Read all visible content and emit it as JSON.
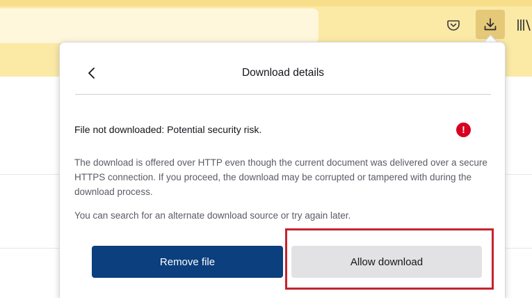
{
  "toolbar": {
    "pocket_icon": "pocket-icon",
    "downloads_icon": "download-arrow-icon",
    "library_icon": "library-icon",
    "accent_color": "#fbe9a6"
  },
  "panel": {
    "title": "Download details",
    "back_icon": "chevron-left-icon",
    "warning_heading": "File not downloaded: Potential security risk.",
    "warning_icon_glyph": "!",
    "warning_body": "The download is offered over HTTP even though the current document was delivered over a secure HTTPS connection. If you proceed, the download may be corrupted or tampered with during the download process.",
    "warning_hint": "You can search for an alternate download source or try again later.",
    "remove_label": "Remove file",
    "allow_label": "Allow download",
    "primary_color": "#0b3f7e",
    "warning_color": "#d70022",
    "highlight_color": "#c5222e"
  }
}
